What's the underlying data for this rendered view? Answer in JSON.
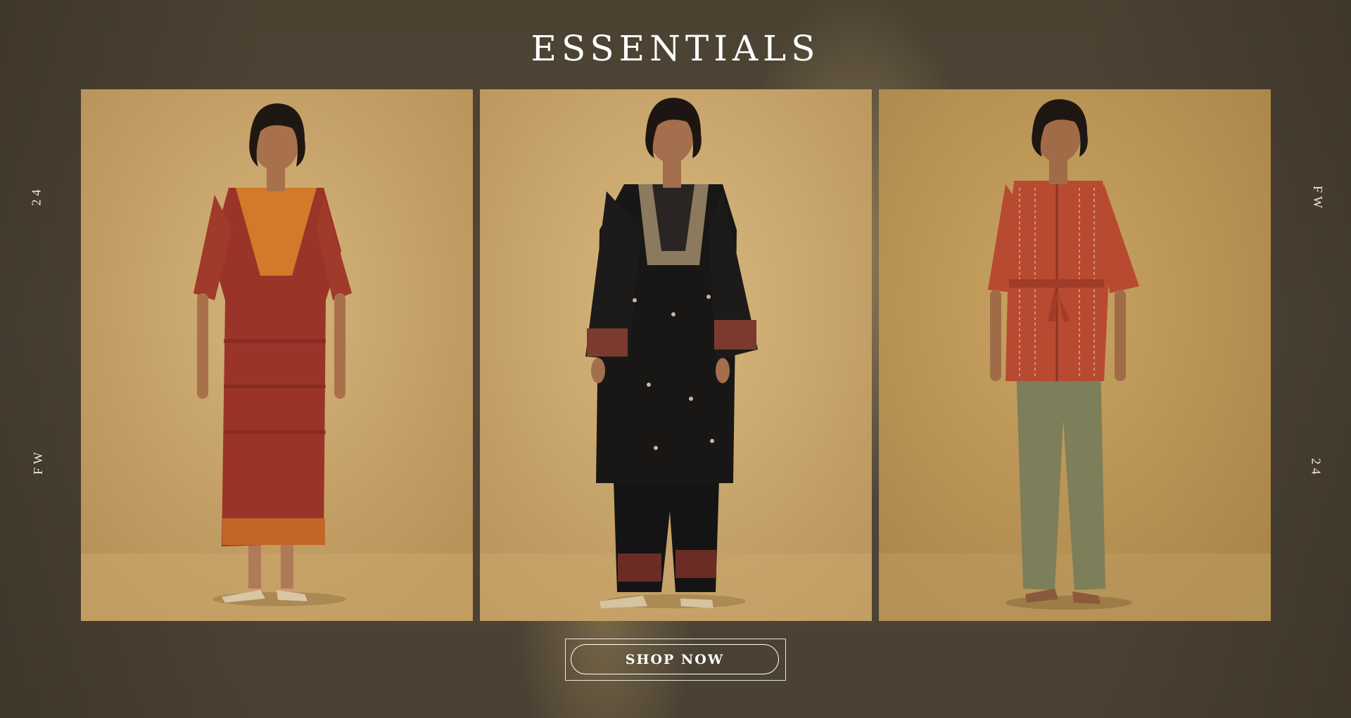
{
  "page": {
    "title": "ESSENTIALS",
    "side_labels": {
      "left_top": "24",
      "left_bottom": "FW",
      "right_top": "FW",
      "right_bottom": "24"
    }
  },
  "cta": {
    "label": "SHOP NOW"
  },
  "colors": {
    "background": "#4a4131",
    "panel_background": "#c9a66b",
    "title_text": "#ffffff",
    "button_border": "#ffffff"
  },
  "panels": [
    {
      "icon": "model-photo-rust-kaftan-dress"
    },
    {
      "icon": "model-photo-black-embroidered-kurta-set"
    },
    {
      "icon": "model-photo-red-striped-shirt-olive-pants"
    }
  ]
}
